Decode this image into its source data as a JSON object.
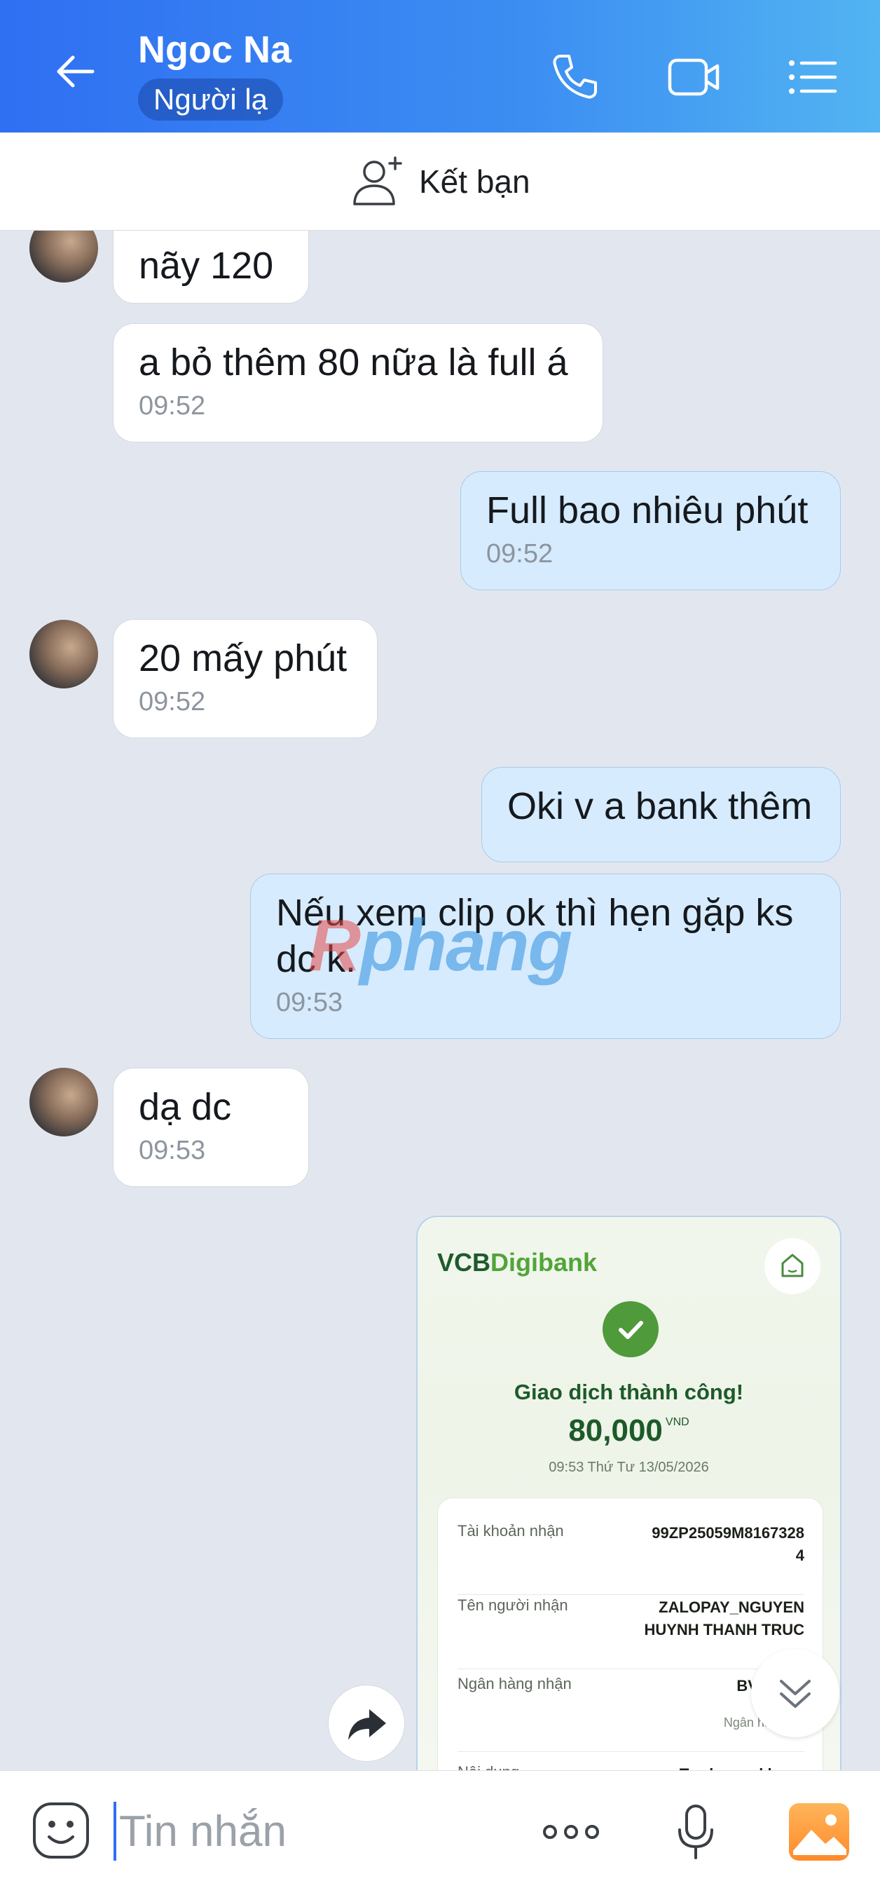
{
  "header": {
    "contact_name": "Ngoc Na",
    "badge": "Người lạ"
  },
  "friend_bar": {
    "label": "Kết bạn"
  },
  "messages": [
    {
      "dir": "in",
      "text": "nãy 120",
      "time": ""
    },
    {
      "dir": "in",
      "text": "a bỏ thêm 80 nữa là full á",
      "time": "09:52"
    },
    {
      "dir": "out",
      "text": "Full bao nhiêu phút",
      "time": "09:52"
    },
    {
      "dir": "in",
      "text": "20 mấy phút",
      "time": "09:52"
    },
    {
      "dir": "out",
      "text": "Oki v a bank thêm",
      "time": ""
    },
    {
      "dir": "out",
      "text": "Nếu xem clip ok thì hẹn gặp ks dc k.",
      "time": "09:53"
    },
    {
      "dir": "in",
      "text": "dạ dc",
      "time": "09:53"
    }
  ],
  "receipt": {
    "bank_brand_a": "VCB",
    "bank_brand_b": "Digibank",
    "status": "Giao dịch thành công!",
    "amount": "80,000",
    "currency": "VND",
    "datetime": "09:53 Thứ Tư 13/05/2026",
    "rows": [
      {
        "label": "Tài khoản nhận",
        "value": "99ZP25059M8167328\n4"
      },
      {
        "label": "Tên người nhận",
        "value": "ZALOPAY_NGUYEN\nHUYNH THANH TRUC"
      },
      {
        "label": "Ngân hàng nhận",
        "value": "BVBank I",
        "sub": "Ngân hàng Ba"
      },
      {
        "label": "Nội dung",
        "value": "Tc chuyen khoan"
      }
    ]
  },
  "watermark": {
    "r": "R",
    "rest": "phang"
  },
  "composer": {
    "placeholder": "Tin nhắn"
  },
  "colors": {
    "header_start": "#2f6ff2",
    "header_end": "#52b4f2",
    "out_bubble": "#d6ebfd",
    "in_bubble": "#ffffff"
  }
}
